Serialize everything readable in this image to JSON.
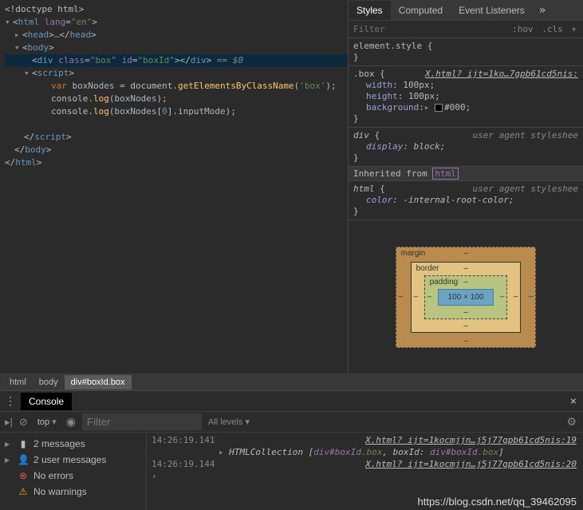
{
  "dom": {
    "doctype": "<!doctype html>",
    "html_open": "html",
    "lang_attr": "lang",
    "lang_val": "\"en\"",
    "head_open": "head",
    "head_ell": "…",
    "head_close": "head",
    "body_open": "body",
    "div_tag": "div",
    "class_attr": "class",
    "class_val": "\"box\"",
    "id_attr": "id",
    "id_val": "\"boxId\"",
    "eq0": "== $0",
    "script_tag": "script",
    "js": {
      "var": "var",
      "boxNodes": "boxNodes",
      "eq": " = ",
      "document": "document",
      "getByCls": "getElementsByClassName",
      "boxstr": "'box'",
      "console": "console",
      "log": "log",
      "zero": "0",
      "inputMode": "inputMode"
    },
    "body_close": "body",
    "html_close": "html"
  },
  "styles": {
    "tabs": {
      "styles": "Styles",
      "computed": "Computed",
      "listeners": "Event Listeners",
      "more": "»"
    },
    "filter_ph": "Filter",
    "hov": ":hov",
    "cls": ".cls",
    "plus": "+",
    "element_style": "element.style",
    "box_sel": ".box",
    "box_link": "X.html? ijt=1ko…7gpb61cd5nis:",
    "width_prop": "width",
    "width_val": "100px",
    "height_prop": "height",
    "height_val": "100px",
    "bg_prop": "background",
    "bg_val": "#000",
    "div_sel": "div",
    "ua_label": "user agent styleshee",
    "display_prop": "display",
    "display_val": "block",
    "inherit_text": "Inherited from ",
    "inherit_html": "html",
    "html_sel": "html",
    "color_prop": "color",
    "color_val": "-internal-root-color",
    "bm": {
      "margin": "margin",
      "border": "border",
      "padding": "padding",
      "content": "100 × 100",
      "dash": "–"
    }
  },
  "breadcrumb": {
    "html": "html",
    "body": "body",
    "div": "div#boxId.box"
  },
  "console": {
    "tab": "Console",
    "top": "top",
    "filter_ph": "Filter",
    "levels": "All levels",
    "sidebar": {
      "messages": "2 messages",
      "user": "2 user messages",
      "errors": "No errors",
      "warnings": "No warnings"
    },
    "rows": {
      "t1": "14:26:19.141",
      "link1": "X.html? ijt=1kocmjjn…j5j77gpb61cd5nis:19",
      "coll": "HTMLCollection",
      "br_open": " [",
      "s1a": "div#",
      "s1b": "boxId",
      "s1c": ".box",
      "comma": ", ",
      "key": "boxId: ",
      "s2a": "div",
      "s2b": "#boxId",
      "s2c": ".box",
      "br_close": "]",
      "t2": "14:26:19.144",
      "link2": "X.html? ijt=1kocmjjn…j5j77gpb61cd5nis:20"
    }
  },
  "watermark": "https://blog.csdn.net/qq_39462095"
}
